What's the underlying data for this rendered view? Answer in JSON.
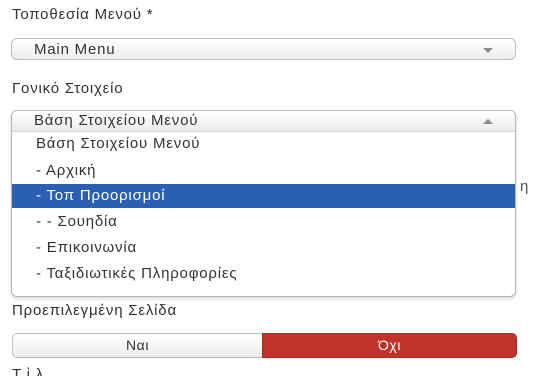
{
  "menu_location": {
    "label": "Τοποθεσία Μενού *",
    "selected_value": "Main Menu"
  },
  "parent_item": {
    "label": "Γονικό Στοιχείο",
    "selected_value": "Βάση Στοιχείου Μενού",
    "options": [
      {
        "label": "Βάση Στοιχείου Μενού",
        "selected": false
      },
      {
        "label": "- Αρχική",
        "selected": false
      },
      {
        "label": "- Τοπ Προορισμοί",
        "selected": true
      },
      {
        "label": "- - Σουηδία",
        "selected": false
      },
      {
        "label": "- Επικοινωνία",
        "selected": false
      },
      {
        "label": "- Ταξιδιωτικές Πληροφορίες",
        "selected": false
      }
    ],
    "side_fragment": "η"
  },
  "default_page": {
    "label": "Προεπιλεγμένη Σελίδα",
    "yes_label": "Ναι",
    "no_label": "Όχι",
    "active": "no"
  },
  "next_section_fragment": "Τ   ἱ  λ",
  "colors": {
    "highlight": "#2b5fb3",
    "no_active": "#c0332b"
  }
}
